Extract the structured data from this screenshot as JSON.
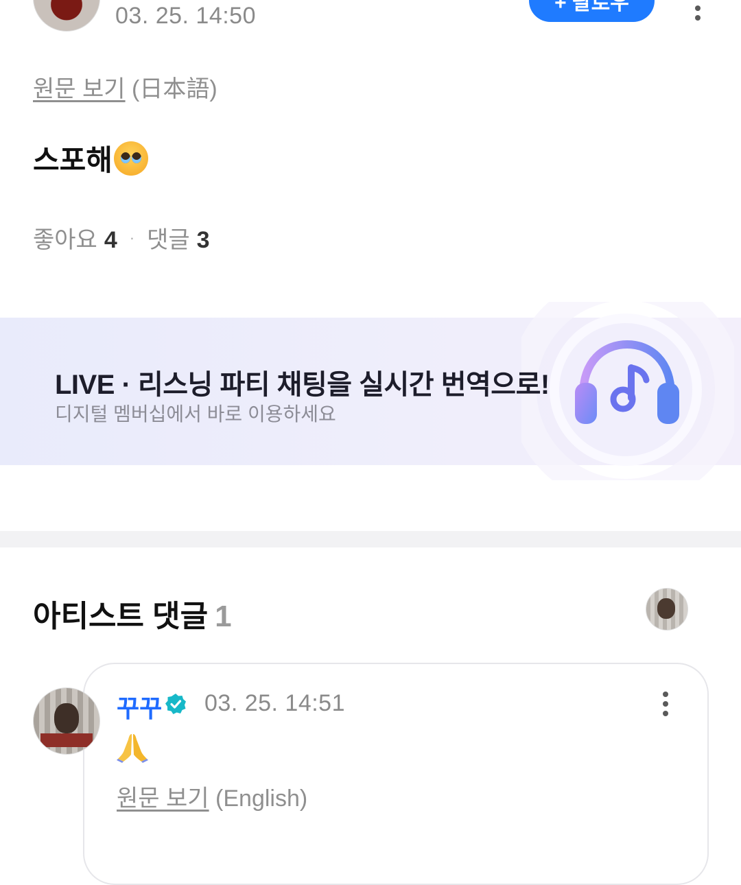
{
  "post": {
    "time": "03. 25. 14:50",
    "follow_label": "+ 팔로우",
    "view_original_link": "원문 보기",
    "view_original_lang": "(日本語)",
    "text": "스포해",
    "emoji_icon": "pleading-face-emoji",
    "likes_label": "좋아요",
    "likes_count": "4",
    "comments_label": "댓글",
    "comments_count": "3",
    "separator": "·"
  },
  "banner": {
    "title": "LIVE · 리스닝 파티 채팅을 실시간 번역으로!",
    "subtitle": "디지털 멤버십에서 바로 이용하세요",
    "icon": "headphones-music-icon"
  },
  "artist_comments": {
    "heading": "아티스트 댓글",
    "count": "1",
    "comment": {
      "author": "꾸꾸",
      "verified_icon": "verified-badge-icon",
      "time": "03. 25. 14:51",
      "emoji": "🙏",
      "view_original_link": "원문 보기",
      "view_original_lang": "(English)"
    }
  },
  "colors": {
    "accent_blue": "#1f7bff",
    "author_blue": "#1f6bff",
    "verified_teal": "#17b8c8",
    "muted_text": "#8f8f8f",
    "banner_bg": "#eceaf9"
  }
}
